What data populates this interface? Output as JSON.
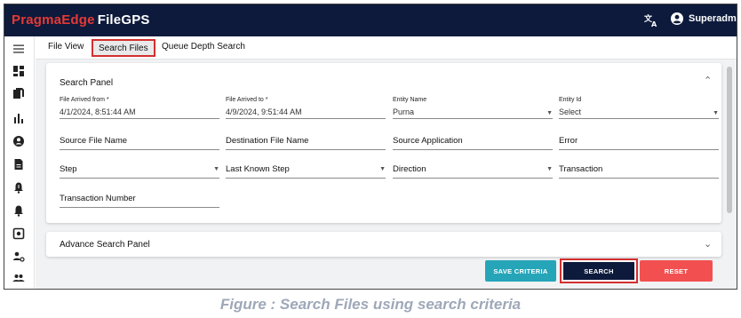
{
  "app": {
    "brand_first": "PragmaEdge",
    "brand_second": "FileGPS",
    "user_name": "Superadmin",
    "translate_icon": "translate-icon",
    "user_icon": "account-circle-icon"
  },
  "sidebar": {
    "icons": [
      "menu-icon",
      "dashboard-icon",
      "files-icon",
      "bar-chart-icon",
      "account-icon",
      "document-icon",
      "alert-bell-icon",
      "alert-settings-icon",
      "settings-box-icon",
      "user-settings-icon",
      "group-icon"
    ]
  },
  "tabs": [
    {
      "label": "File View"
    },
    {
      "label": "Search Files"
    },
    {
      "label": "Queue Depth Search"
    }
  ],
  "search_panel": {
    "title": "Search Panel",
    "fields": {
      "arrived_from_label": "File Arrived from *",
      "arrived_from_value": "4/1/2024, 8:51:44 AM",
      "arrived_to_label": "File Arrived to *",
      "arrived_to_value": "4/9/2024, 9:51:44 AM",
      "entity_name_label": "Entity Name",
      "entity_name_value": "Purna",
      "entity_id_label": "Entity Id",
      "entity_id_value": "Select",
      "source_file_name": "Source File Name",
      "destination_file_name": "Destination File Name",
      "source_application": "Source Application",
      "error": "Error",
      "step": "Step",
      "last_known_step": "Last Known Step",
      "direction": "Direction",
      "transaction": "Transaction",
      "transaction_number": "Transaction Number"
    }
  },
  "advance_panel": {
    "title": "Advance Search Panel"
  },
  "buttons": {
    "save_criteria": "SAVE CRITERIA",
    "search": "SEARCH",
    "reset": "RESET"
  },
  "caption": "Figure : Search Files using search criteria",
  "colors": {
    "topbar": "#0d1a3c",
    "brand_red": "#e53935",
    "save_button": "#26a5b8",
    "search_button": "#0d1a3c",
    "reset_button": "#f25050",
    "highlight_border": "#d32f2f"
  }
}
